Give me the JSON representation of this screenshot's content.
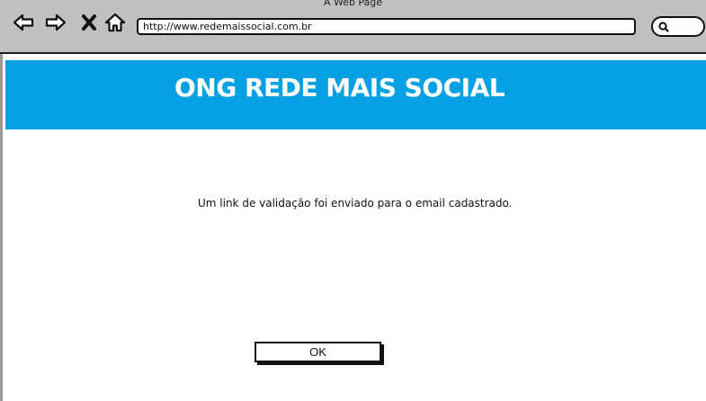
{
  "browser": {
    "window_title": "A Web Page",
    "url": "http://www.redemaissocial.com.br",
    "icons": [
      "back-arrow-icon",
      "forward-arrow-icon",
      "close-x-icon",
      "home-icon",
      "search-icon"
    ]
  },
  "header": {
    "title": "ONG REDE MAIS SOCIAL",
    "background_color": "#03a1e4"
  },
  "main": {
    "message": "Um link de validação foi enviado para o email cadastrado.",
    "ok_label": "OK"
  }
}
